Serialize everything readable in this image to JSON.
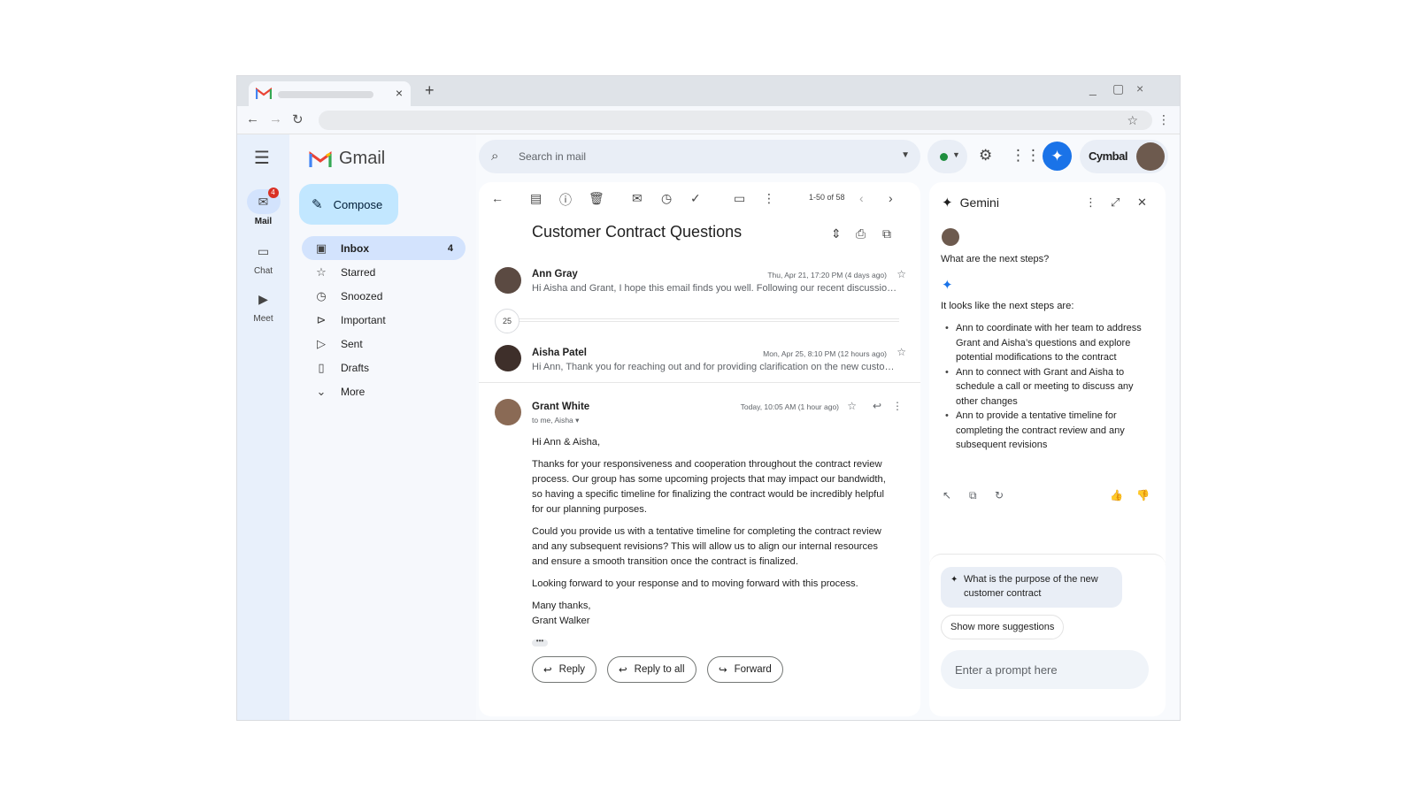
{
  "browser": {
    "tab_close": "×",
    "new_tab": "+",
    "minimize": "_",
    "maximize": "▢",
    "close": "×"
  },
  "gmail": {
    "logo_text": "Gmail",
    "search_placeholder": "Search in mail",
    "account_name": "Cymbal",
    "rail": [
      {
        "label": "Mail",
        "icon": "mail-icon",
        "badge": "4",
        "active": true
      },
      {
        "label": "Chat",
        "icon": "chat-icon"
      },
      {
        "label": "Meet",
        "icon": "video-icon"
      }
    ],
    "compose_label": "Compose",
    "nav": [
      {
        "label": "Inbox",
        "icon": "inbox-icon",
        "count": "4",
        "active": true
      },
      {
        "label": "Starred",
        "icon": "star-icon"
      },
      {
        "label": "Snoozed",
        "icon": "clock-icon"
      },
      {
        "label": "Important",
        "icon": "important-icon"
      },
      {
        "label": "Sent",
        "icon": "send-icon"
      },
      {
        "label": "Drafts",
        "icon": "draft-icon"
      },
      {
        "label": "More",
        "icon": "chevron-down-icon"
      }
    ]
  },
  "mail": {
    "pagination": "1-50 of 58",
    "subject": "Customer Contract Questions",
    "collapsed_count": "25",
    "messages": [
      {
        "sender": "Ann Gray",
        "date": "Thu, Apr 21, 17:20 PM (4 days ago)",
        "snippet": "Hi Aisha and Grant, I hope this email finds you well. Following our recent discussion regarding the customer contract"
      },
      {
        "sender": "Aisha Patel",
        "date": "Mon, Apr 25, 8:10 PM (12 hours ago)",
        "snippet": "Hi Ann, Thank you for reaching out and for providing clarification on the new customer contract"
      }
    ],
    "open_message": {
      "sender": "Grant White",
      "to": "to me, Aisha",
      "date": "Today, 10:05 AM (1 hour ago)",
      "greeting": "Hi Ann & Aisha,",
      "paragraphs": [
        "Thanks for your responsiveness and cooperation throughout the contract review process. Our group has some upcoming projects that may impact our bandwidth, so having a specific timeline for finalizing the contract would be incredibly helpful for our planning purposes.",
        "Could you provide us with a tentative timeline for completing the contract review and any subsequent revisions? This will allow us to align our internal resources and ensure a smooth transition once the contract is finalized.",
        "Looking forward to your response and to moving forward with this process."
      ],
      "signoff": "Many thanks,",
      "signature": "Grant Walker",
      "ellipsis": "•••"
    },
    "actions": {
      "reply": "Reply",
      "reply_all": "Reply to all",
      "forward": "Forward"
    }
  },
  "gemini": {
    "title": "Gemini",
    "question": "What are the next steps?",
    "lead": "It looks like the next steps are:",
    "steps": [
      "Ann to coordinate with her team to address Grant and Aisha’s questions and explore potential modifications to the contract",
      "Ann to connect with Grant and Aisha to schedule a call or meeting to discuss any other changes",
      "Ann to provide a tentative timeline for completing the contract review and any subsequent revisions"
    ],
    "suggestion": "What is the purpose of the new customer contract",
    "more_suggestions": "Show more suggestions",
    "prompt_placeholder": "Enter a prompt here"
  },
  "colors": {
    "accent": "#1a73e8",
    "compose_bg": "#c2e7ff",
    "active_nav": "#d3e3fd",
    "badge": "#d93025",
    "status": "#1e8e3e"
  }
}
